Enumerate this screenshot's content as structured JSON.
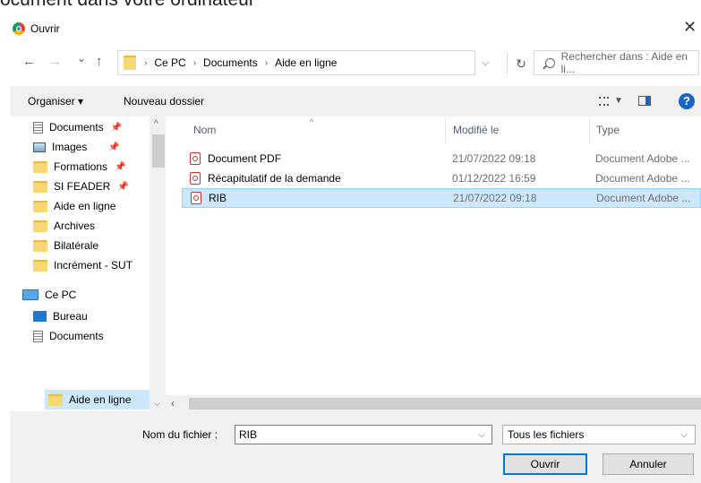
{
  "background": {
    "heading_fragment": "ocument dans votre ordinateur"
  },
  "window": {
    "title": "Ouvrir",
    "close": "✕"
  },
  "nav": {
    "back": "←",
    "forward": "→",
    "history": "⌄",
    "up": "↑",
    "breadcrumb": [
      "Ce PC",
      "Documents",
      "Aide en ligne"
    ],
    "search_placeholder": "Rechercher dans : Aide en li..."
  },
  "toolbar": {
    "organize": "Organiser ▾",
    "new_folder": "Nouveau dossier",
    "help": "?"
  },
  "sidebar": {
    "items": [
      {
        "label": "Documents",
        "icon": "documents-icon",
        "pinned": true
      },
      {
        "label": "Images",
        "icon": "images-icon",
        "pinned": true
      },
      {
        "label": "Formations",
        "icon": "folder-icon",
        "pinned": true
      },
      {
        "label": "SI FEADER",
        "icon": "folder-icon",
        "pinned": true
      },
      {
        "label": "Aide en ligne",
        "icon": "folder-icon",
        "pinned": false
      },
      {
        "label": "Archives",
        "icon": "folder-icon",
        "pinned": false
      },
      {
        "label": "Bilatérale",
        "icon": "folder-icon",
        "pinned": false
      },
      {
        "label": "Incrément - SUT",
        "icon": "folder-icon",
        "pinned": false
      },
      {
        "label": "Ce PC",
        "icon": "computer-icon",
        "pinned": false
      },
      {
        "label": "Bureau",
        "icon": "desktop-icon",
        "pinned": false
      },
      {
        "label": "Documents",
        "icon": "documents-icon",
        "pinned": false
      },
      {
        "label": "Aide en ligne",
        "icon": "folder-icon",
        "pinned": false,
        "selected": true
      }
    ]
  },
  "files": {
    "columns": [
      "Nom",
      "Modifié le",
      "Type"
    ],
    "rows": [
      {
        "name": "Document PDF",
        "modified": "21/07/2022 09:18",
        "type": "Document Adobe ..."
      },
      {
        "name": "Récapitulatif de la demande",
        "modified": "01/12/2022 16:59",
        "type": "Document Adobe ..."
      },
      {
        "name": "RIB",
        "modified": "21/07/2022 09:18",
        "type": "Document Adobe ...",
        "selected": true
      }
    ]
  },
  "footer": {
    "filename_label": "Nom du fichier :",
    "filename_value": "RIB",
    "filetype_value": "Tous les fichiers",
    "open_label": "Ouvrir",
    "cancel_label": "Annuler"
  },
  "colors": {
    "accent": "#0078d7",
    "selection": "#cce8ff",
    "folder": "#f8d775",
    "pdf": "#d32f2f"
  }
}
